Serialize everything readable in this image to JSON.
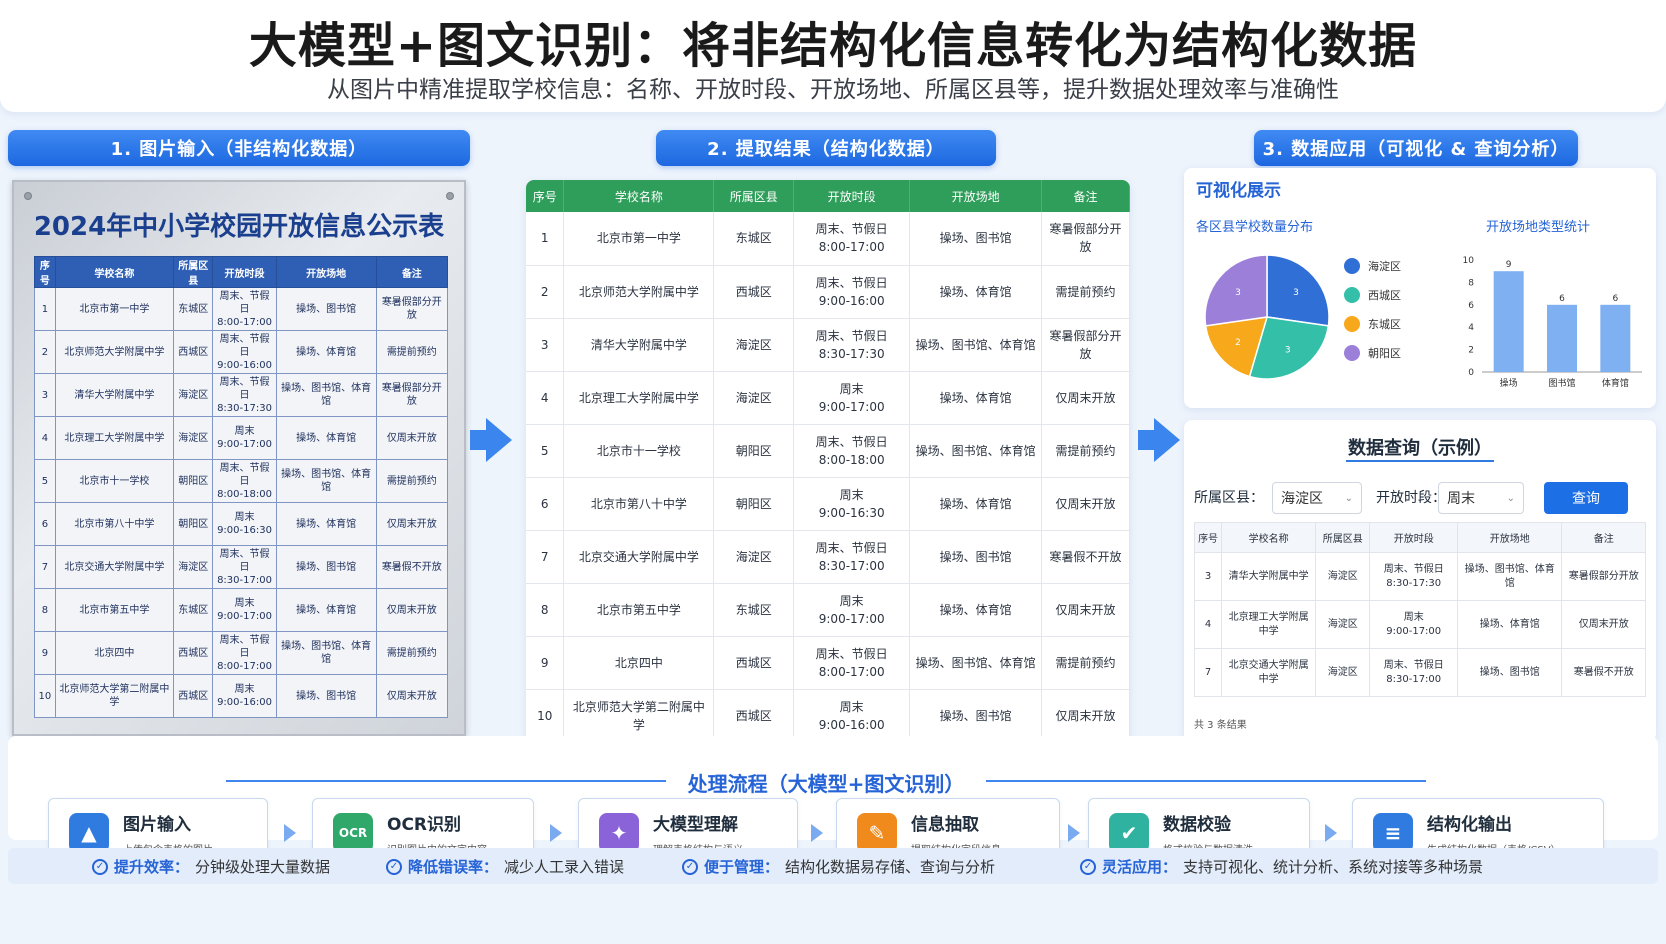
{
  "header": {
    "title": "大模型+图文识别：将非结构化信息转化为结构化数据",
    "subtitle": "从图片中精准提取学校信息：名称、开放时段、开放场地、所属区县等，提升数据处理效率与准确性"
  },
  "sections": {
    "s1": "1. 图片输入（非结构化数据）",
    "s2": "2. 提取结果（结构化数据）",
    "s3": "3. 数据应用（可视化 & 查询分析）"
  },
  "photo": {
    "title": "2024年中小学校园开放信息公示表",
    "headers": [
      "序号",
      "学校名称",
      "所属区县",
      "开放时段",
      "开放场地",
      "备注"
    ],
    "rows": [
      [
        "1",
        "北京市第一中学",
        "东城区",
        "周末、节假日\n8:00-17:00",
        "操场、图书馆",
        "寒暑假部分开放"
      ],
      [
        "2",
        "北京师范大学附属中学",
        "西城区",
        "周末、节假日\n9:00-16:00",
        "操场、体育馆",
        "需提前预约"
      ],
      [
        "3",
        "清华大学附属中学",
        "海淀区",
        "周末、节假日\n8:30-17:30",
        "操场、图书馆、体育馆",
        "寒暑假部分开放"
      ],
      [
        "4",
        "北京理工大学附属中学",
        "海淀区",
        "周末\n9:00-17:00",
        "操场、体育馆",
        "仅周末开放"
      ],
      [
        "5",
        "北京市十一学校",
        "朝阳区",
        "周末、节假日\n8:00-18:00",
        "操场、图书馆、体育馆",
        "需提前预约"
      ],
      [
        "6",
        "北京市第八十中学",
        "朝阳区",
        "周末\n9:00-16:30",
        "操场、体育馆",
        "仅周末开放"
      ],
      [
        "7",
        "北京交通大学附属中学",
        "海淀区",
        "周末、节假日\n8:30-17:00",
        "操场、图书馆",
        "寒暑假不开放"
      ],
      [
        "8",
        "北京市第五中学",
        "东城区",
        "周末\n9:00-17:00",
        "操场、体育馆",
        "仅周末开放"
      ],
      [
        "9",
        "北京四中",
        "西城区",
        "周末、节假日\n8:00-17:00",
        "操场、图书馆、体育馆",
        "需提前预约"
      ],
      [
        "10",
        "北京师范大学第二附属中学",
        "西城区",
        "周末\n9:00-16:00",
        "操场、图书馆",
        "仅周末开放"
      ]
    ]
  },
  "extract": {
    "headers": [
      "序号",
      "学校名称",
      "所属区县",
      "开放时段",
      "开放场地",
      "备注"
    ],
    "rows": [
      [
        "1",
        "北京市第一中学",
        "东城区",
        "周末、节假日\n8:00-17:00",
        "操场、图书馆",
        "寒暑假部分开放"
      ],
      [
        "2",
        "北京师范大学附属中学",
        "西城区",
        "周末、节假日\n9:00-16:00",
        "操场、体育馆",
        "需提前预约"
      ],
      [
        "3",
        "清华大学附属中学",
        "海淀区",
        "周末、节假日\n8:30-17:30",
        "操场、图书馆、体育馆",
        "寒暑假部分开放"
      ],
      [
        "4",
        "北京理工大学附属中学",
        "海淀区",
        "周末\n9:00-17:00",
        "操场、体育馆",
        "仅周末开放"
      ],
      [
        "5",
        "北京市十一学校",
        "朝阳区",
        "周末、节假日\n8:00-18:00",
        "操场、图书馆、体育馆",
        "需提前预约"
      ],
      [
        "6",
        "北京市第八十中学",
        "朝阳区",
        "周末\n9:00-16:30",
        "操场、体育馆",
        "仅周末开放"
      ],
      [
        "7",
        "北京交通大学附属中学",
        "海淀区",
        "周末、节假日\n8:30-17:00",
        "操场、图书馆",
        "寒暑假不开放"
      ],
      [
        "8",
        "北京市第五中学",
        "东城区",
        "周末\n9:00-17:00",
        "操场、体育馆",
        "仅周末开放"
      ],
      [
        "9",
        "北京四中",
        "西城区",
        "周末、节假日\n8:00-17:00",
        "操场、图书馆、体育馆",
        "需提前预约"
      ],
      [
        "10",
        "北京师范大学第二附属中学",
        "西城区",
        "周末\n9:00-16:00",
        "操场、图书馆",
        "仅周末开放"
      ]
    ]
  },
  "viz": {
    "title": "可视化展示",
    "pie_title": "各区县学校数量分布",
    "bar_title": "开放场地类型统计"
  },
  "chart_data": [
    {
      "type": "pie",
      "title": "各区县学校数量分布",
      "labels": [
        "海淀区",
        "西城区",
        "东城区",
        "朝阳区"
      ],
      "values": [
        3,
        3,
        2,
        3
      ],
      "colors": [
        "#2f6fd6",
        "#33bfa8",
        "#f7a81b",
        "#9b7fd9"
      ]
    },
    {
      "type": "bar",
      "title": "开放场地类型统计",
      "categories": [
        "操场",
        "图书馆",
        "体育馆"
      ],
      "values": [
        9,
        6,
        6
      ],
      "ylim": [
        0,
        10
      ],
      "yticks": [
        "0",
        "2",
        "4",
        "6",
        "8",
        "10"
      ],
      "color": "#7fb0f2"
    }
  ],
  "query": {
    "title": "数据查询（示例）",
    "district_label": "所属区县：",
    "district_value": "海淀区",
    "time_label": "开放时段：",
    "time_value": "周末",
    "button": "查询",
    "headers": [
      "序号",
      "学校名称",
      "所属区县",
      "开放时段",
      "开放场地",
      "备注"
    ],
    "rows": [
      [
        "3",
        "清华大学附属中学",
        "海淀区",
        "周末、节假日\n8:30-17:30",
        "操场、图书馆、体育馆",
        "寒暑假部分开放"
      ],
      [
        "4",
        "北京理工大学附属中学",
        "海淀区",
        "周末\n9:00-17:00",
        "操场、体育馆",
        "仅周末开放"
      ],
      [
        "7",
        "北京交通大学附属中学",
        "海淀区",
        "周末、节假日\n8:30-17:00",
        "操场、图书馆",
        "寒暑假不开放"
      ]
    ],
    "count": "共 3 条结果"
  },
  "flow": {
    "title": "处理流程（大模型+图文识别）",
    "steps": [
      {
        "title": "图片输入",
        "desc": "上传包含表格的图片",
        "color": "#2f7be0",
        "icon": "image-icon"
      },
      {
        "title": "OCR识别",
        "desc": "识别图片中的文字内容",
        "color": "#2fa86a",
        "icon": "ocr-icon",
        "glyph": "OCR"
      },
      {
        "title": "大模型理解",
        "desc": "理解表格结构与语义",
        "color": "#8b63d9",
        "icon": "ai-brain-icon"
      },
      {
        "title": "信息抽取",
        "desc": "提取结构化字段信息",
        "color": "#f08a1c",
        "icon": "extract-icon"
      },
      {
        "title": "数据校验",
        "desc": "格式校验与数据清洗",
        "color": "#2fb3a0",
        "icon": "check-icon"
      },
      {
        "title": "结构化输出",
        "desc": "生成结构化数据（表格/CSV）",
        "color": "#2f7be0",
        "icon": "database-icon"
      }
    ]
  },
  "benefits": [
    {
      "k": "提升效率：",
      "v": "分钟级处理大量数据"
    },
    {
      "k": "降低错误率：",
      "v": "减少人工录入错误"
    },
    {
      "k": "便于管理：",
      "v": "结构化数据易存储、查询与分析"
    },
    {
      "k": "灵活应用：",
      "v": "支持可视化、统计分析、系统对接等多种场景"
    }
  ]
}
